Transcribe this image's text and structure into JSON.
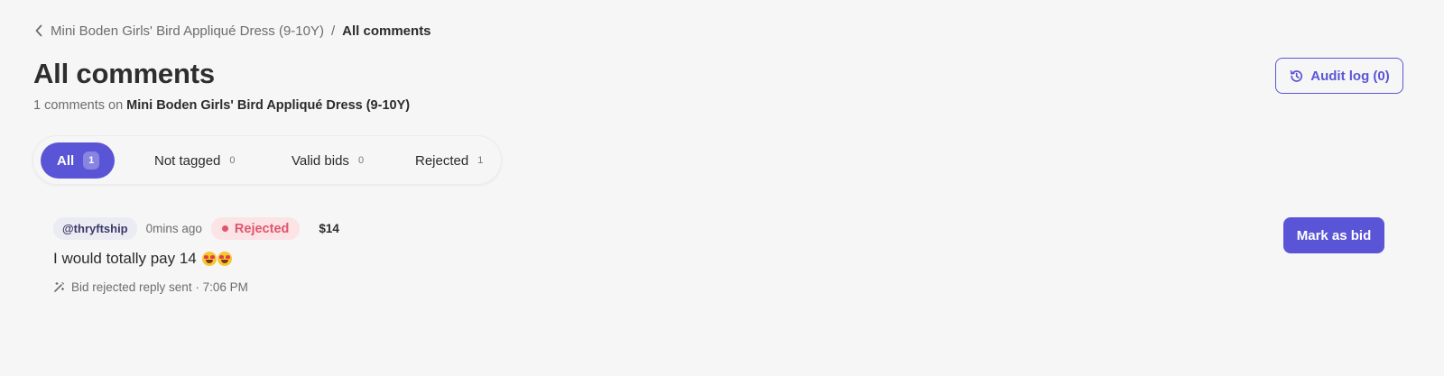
{
  "breadcrumb": {
    "back_icon": "chevron-left-icon",
    "parent": "Mini Boden Girls' Bird Appliqué Dress (9-10Y)",
    "separator": "/",
    "current": "All comments"
  },
  "header": {
    "title": "All comments",
    "subtitle_prefix": "1 comments on",
    "product_name": "Mini Boden Girls' Bird Appliqué Dress (9-10Y)",
    "audit_button": {
      "icon": "history-icon",
      "label": "Audit log (0)"
    }
  },
  "tabs": [
    {
      "label": "All",
      "count": "1",
      "active": true
    },
    {
      "label": "Not tagged",
      "count": "0",
      "active": false
    },
    {
      "label": "Valid bids",
      "count": "0",
      "active": false
    },
    {
      "label": "Rejected",
      "count": "1",
      "active": false
    }
  ],
  "comments": [
    {
      "handle": "@thryftship",
      "time": "0mins ago",
      "status": "Rejected",
      "price": "$14",
      "text": "I would totally pay 14",
      "emoji": "heart-eyes-emoji",
      "reply_status": "Bid rejected reply sent · 7:06 PM",
      "reply_icon": "magic-wand-icon",
      "action_label": "Mark as bid"
    }
  ],
  "colors": {
    "accent": "#5a55d6",
    "rejected": "#e0566a",
    "rejected_bg": "#fbe3e6",
    "background": "#f6f6f6"
  }
}
